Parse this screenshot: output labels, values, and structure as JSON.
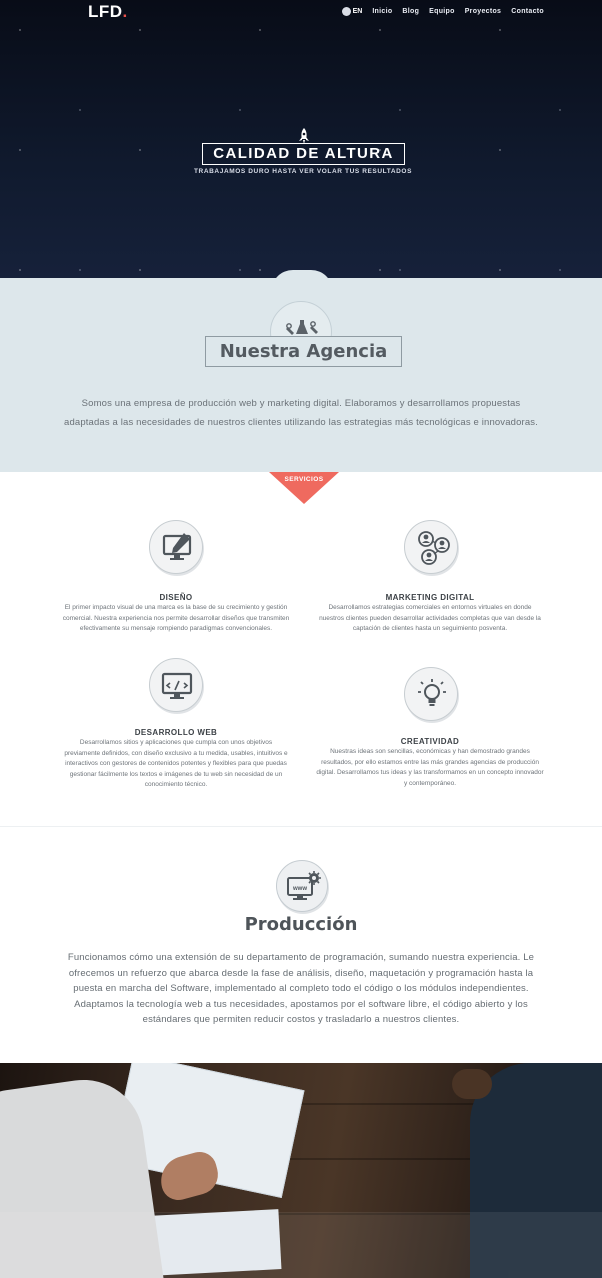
{
  "header": {
    "logo_text": "LFD",
    "logo_dot": ".",
    "lang": "EN",
    "nav": [
      "Inicio",
      "Blog",
      "Equipo",
      "Proyectos",
      "Contacto"
    ]
  },
  "hero": {
    "title": "CALIDAD DE ALTURA",
    "subtitle": "TRABAJAMOS DURO HASTA VER VOLAR TUS RESULTADOS"
  },
  "agency": {
    "title": "Nuestra Agencia",
    "text": "Somos una empresa de producción web y marketing digital. Elaboramos y desarrollamos propuestas adaptadas a las necesidades de nuestros clientes utilizando las estrategias más tecnológicas e innovadoras.",
    "tab_label": "SERVICIOS"
  },
  "services": [
    {
      "title": "DISEÑO",
      "icon": "monitor-pen-icon",
      "text": "El primer impacto visual de una marca es la base de su crecimiento y gestión comercial. Nuestra experiencia nos permite desarrollar diseños que transmiten efectivamente su mensaje rompiendo paradigmas convencionales."
    },
    {
      "title": "MARKETING DIGITAL",
      "icon": "users-network-icon",
      "text": "Desarrollamos estrategias comerciales en entornos virtuales en donde nuestros clientes pueden desarrollar actividades completas que van desde la captación de clientes hasta un seguimiento posventa."
    },
    {
      "title": "DESARROLLO WEB",
      "icon": "monitor-code-icon",
      "text": "Desarrollamos sitios y aplicaciones que cumpla con unos objetivos previamente definidos, con diseño exclusivo a tu medida, usables, intuitivos e interactivos con gestores de contenidos potentes y flexibles para que puedas gestionar fácilmente los textos e imágenes de tu web sin necesidad de un conocimiento técnico."
    },
    {
      "title": "CREATIVIDAD",
      "icon": "lightbulb-icon",
      "text": "Nuestras ideas son sencillas, económicas y han demostrado grandes resultados, por ello estamos entre las más grandes agencias de producción digital. Desarrollamos tus ideas y las transformamos en un concepto innovador y contemporáneo."
    }
  ],
  "production": {
    "title": "Producción",
    "icon_text": "www",
    "text": "Funcionamos cómo una extensión de su departamento de programación, sumando nuestra experiencia. Le ofrecemos un refuerzo que abarca desde la fase de análisis, diseño, maquetación y programación hasta la puesta en marcha del Software, implementado al completo todo el código o los módulos independientes. Adaptamos la tecnología web a tus necesidades, apostamos por el software libre, el código abierto y los estándares que permiten reducir costos y trasladarlo a nuestros clientes."
  },
  "colors": {
    "accent": "#ef6a5f",
    "agency_bg": "#dde7eb",
    "hero_bg": "#0c1322"
  }
}
